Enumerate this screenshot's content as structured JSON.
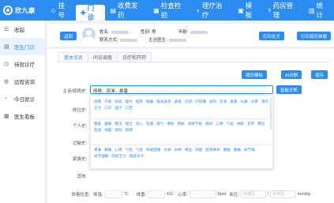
{
  "app": {
    "logo_text": "欣九康"
  },
  "nav": [
    {
      "icon": "☺",
      "label": "挂号"
    },
    {
      "icon": "✚",
      "label": "门诊"
    },
    {
      "icon": "▤",
      "label": "收费发药"
    },
    {
      "icon": "▦",
      "label": "检查检验"
    },
    {
      "icon": "◐",
      "label": "理疗治疗"
    },
    {
      "icon": "▣",
      "label": "模板"
    },
    {
      "icon": "⚕",
      "label": "药房管理"
    },
    {
      "icon": "▥",
      "label": "统计"
    }
  ],
  "sidebar": [
    {
      "icon": "☰",
      "label": "收起"
    },
    {
      "icon": "▤",
      "label": "医生门诊"
    },
    {
      "icon": "◷",
      "label": "待就诊疗"
    },
    {
      "icon": "◍",
      "label": "远程咨询"
    },
    {
      "icon": "◔",
      "label": "今日就诊"
    },
    {
      "icon": "▦",
      "label": "医生看板"
    }
  ],
  "patient": {
    "return_btn": "返回",
    "name_label": "姓名:",
    "gender_label": "性别: 男",
    "age_label": "年龄:",
    "contact_label": "联系方式:",
    "doctor_label": "主治医生:",
    "print_record_btn": "打印处方",
    "print_case_btn": "打印病历单据"
  },
  "tabs": [
    "基本信息",
    "问诊调查",
    "诊疗和开药"
  ],
  "actions": {
    "consult_template": "病历模板",
    "ai_diagnosis": "AI诊断",
    "save": "保存"
  },
  "form": {
    "chief_complaint_label": "主诉/现病史:",
    "chief_complaint_value": "咳嗽、流涕、鼻塞",
    "smart_btn": "智能诊断",
    "history_label": "既往史:",
    "personal_label": "个人史:",
    "allergy_label": "过敏史:",
    "family_label": "家族史:",
    "other_label": "其他:"
  },
  "suggestions": {
    "group1": [
      "咳嗽",
      "干咳",
      "咳痰",
      "咽干",
      "咽痒",
      "咽痛",
      "喉咙发痒",
      "鼻塞",
      "流涕",
      "打喷嚏",
      "发热",
      "流涕",
      "鼻塞",
      "头痛",
      "头晕",
      "耳鸣",
      "乏力",
      "口干",
      "盗汗",
      "口苦"
    ],
    "group2": [
      "腹胀",
      "腹痛",
      "腹泻",
      "呕吐",
      "恶心",
      "反酸",
      "嗳气",
      "便秘",
      "胃胀",
      "食欲不振",
      "胸闷",
      "心悸",
      "气短",
      "失眠",
      "多梦",
      "健忘",
      "焦虑",
      "烦躁",
      "易怒",
      "抑郁"
    ],
    "group3": [
      "胃痛",
      "胸痛",
      "心悸",
      "气短",
      "气促",
      "呼吸困难",
      "水肿",
      "水肿",
      "咯血",
      "消瘦",
      "肢体麻木",
      "腰酸",
      "腰痛",
      "关节痛",
      "关节僵硬",
      "四肢乏力",
      "四肢冰冷"
    ]
  },
  "vitals": {
    "label": "体格检查:",
    "temp_label": "体温:",
    "temp_unit": "°C",
    "weight_label": "体重:",
    "weight_unit": "KG",
    "heart_label": "心率:",
    "heart_unit": "bpm",
    "bp_label": "血压:",
    "systolic_ph": "收缩压",
    "slash": "/",
    "diastolic_ph": "舒张压",
    "bp_unit": "mmHg"
  }
}
